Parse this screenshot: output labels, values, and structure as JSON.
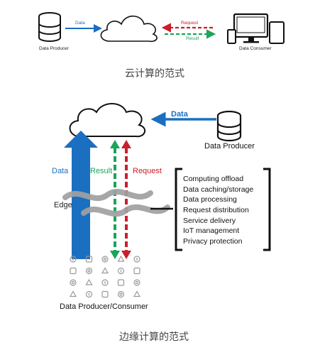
{
  "cloud_paradigm": {
    "producer_label": "Data Producer",
    "consumer_label": "Data Consumer",
    "data_label": "Data",
    "request_label": "Request",
    "result_label": "Result",
    "caption": "云计算的范式"
  },
  "edge_paradigm": {
    "data_label": "Data",
    "producer_label": "Data Producer",
    "result_label": "Result",
    "request_label": "Request",
    "edge_label": "Edge",
    "edge_functions": [
      "Computing offload",
      "Data caching/storage",
      "Data processing",
      "Request distribution",
      "Service delivery",
      "IoT management",
      "Privacy protection"
    ],
    "bottom_label": "Data Producer/Consumer",
    "caption": "边缘计算的范式"
  },
  "colors": {
    "blue": "#1a6fc0",
    "green": "#1aa55a",
    "red": "#c8202a",
    "gray": "#a0a0a0",
    "dark": "#111111"
  },
  "icons": [
    "lightbulb-icon",
    "plug-icon",
    "lock-icon",
    "gauge-icon",
    "speaker-icon",
    "power-icon",
    "gear-icon",
    "house-icon",
    "thermostat-icon",
    "eye-icon",
    "washer-icon",
    "car-icon",
    "wifi-icon",
    "camera-icon",
    "monitor-icon",
    "phone-icon",
    "leaf-icon",
    "fridge-icon",
    "tv-icon",
    "watch-icon"
  ]
}
